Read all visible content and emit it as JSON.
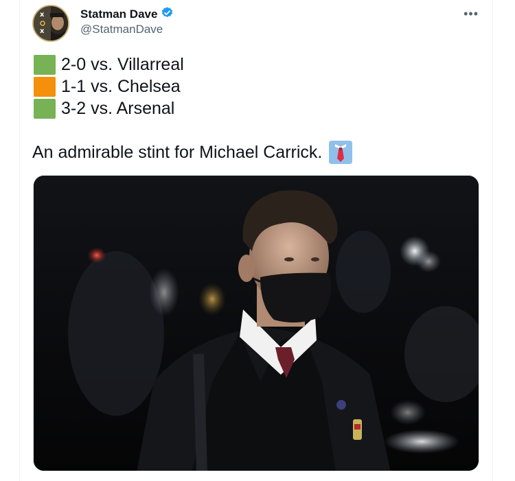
{
  "author": {
    "display_name": "Statman Dave",
    "handle": "@StatmanDave",
    "verified": true
  },
  "more_label": "•••",
  "results": [
    {
      "color": "#77b255",
      "text": "2-0 vs. Villarreal"
    },
    {
      "color": "#f4900c",
      "text": "1-1 vs. Chelsea"
    },
    {
      "color": "#77b255",
      "text": "3-2 vs. Arsenal"
    }
  ],
  "tweet_text": "An admirable stint for Michael Carrick.",
  "icons": {
    "verified": "verified-badge-icon",
    "more": "more-options-icon",
    "emoji": "necktie-emoji-icon"
  },
  "colors": {
    "verified_blue": "#1d9bf0",
    "text": "#0f1419",
    "secondary": "#536471"
  }
}
